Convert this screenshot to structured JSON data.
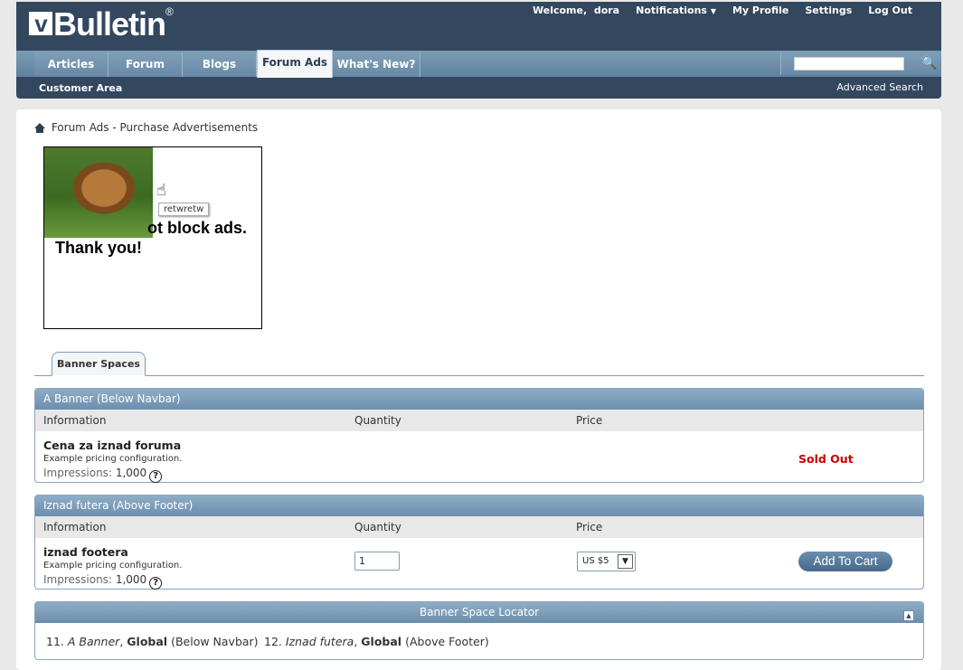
{
  "header": {
    "logo_text": "Bulletin",
    "logo_mark": "v",
    "logo_reg": "®",
    "welcome": "Welcome,",
    "username": "dora",
    "notifications": "Notifications",
    "my_profile": "My Profile",
    "settings": "Settings",
    "logout": "Log Out"
  },
  "nav": {
    "tabs": [
      {
        "label": "Articles"
      },
      {
        "label": "Forum"
      },
      {
        "label": "Blogs"
      },
      {
        "label": "Forum Ads"
      },
      {
        "label": "What's New?"
      }
    ],
    "active_tab": "Forum Ads",
    "search_value": "",
    "customer_area": "Customer Area",
    "advanced_search": "Advanced Search"
  },
  "breadcrumb": "Forum Ads - Purchase Advertisements",
  "ad": {
    "line1": "ot block ads.",
    "line2": "Thank you!",
    "tooltip": "retwretw"
  },
  "tabs": {
    "banner_spaces": "Banner Spaces"
  },
  "columns": {
    "information": "Information",
    "quantity": "Quantity",
    "price": "Price"
  },
  "blocks": [
    {
      "title": "A Banner (Below Navbar)",
      "item_title": "Cena za iznad foruma",
      "item_desc": "Example pricing configuration.",
      "impressions_label": "Impressions:",
      "impressions_value": "1,000",
      "status": "Sold Out"
    },
    {
      "title": "Iznad futera (Above Footer)",
      "item_title": "iznad footera",
      "item_desc": "Example pricing configuration.",
      "impressions_label": "Impressions:",
      "impressions_value": "1,000",
      "quantity": "1",
      "price": "US $5",
      "add_to_cart": "Add To Cart"
    }
  ],
  "locator": {
    "title": "Banner Space Locator",
    "entries": [
      {
        "num": "11.",
        "name": "A Banner",
        "sep": ",",
        "scope": "Global",
        "pos": "(Below Navbar)"
      },
      {
        "num": "12.",
        "name": "Iznad futera",
        "sep": ",",
        "scope": "Global",
        "pos": "(Above Footer)"
      }
    ]
  },
  "colors": {
    "header_bg": "#33475f",
    "nav_bg": "#6889a6",
    "sold_out": "#cc0000",
    "button": "#48698a"
  }
}
